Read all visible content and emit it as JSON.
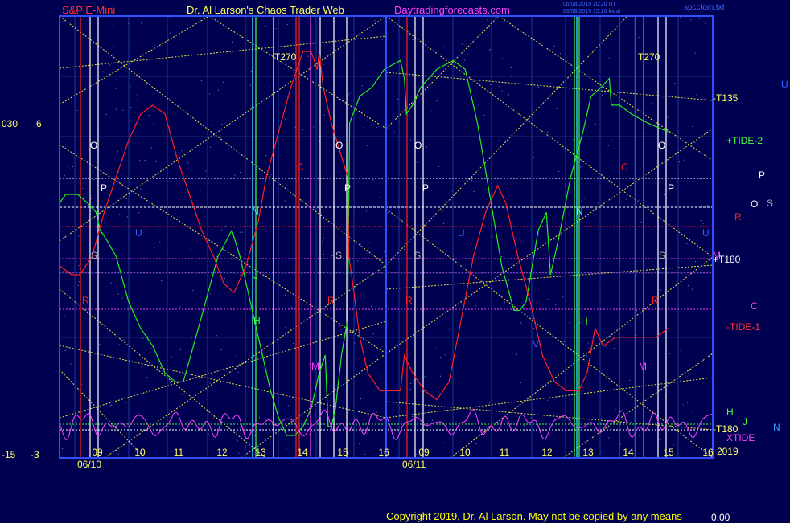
{
  "header": {
    "instrument": "S&P E-Mini",
    "site": "Dr. Al Larson's Chaos Trader Web",
    "url": "Daytradingforecasts.com",
    "stamp1": "06/08/2019 20:20 UT",
    "stamp2": "06/08/2019 15:20 local",
    "file": "spcctom.txt"
  },
  "left_scale": {
    "top_a": "030",
    "top_b": "6",
    "bot_a": "-15",
    "bot_b": "-3"
  },
  "footer": {
    "copyright": "Copyright 2019, Dr. Al Larson. May not be copied by any means",
    "value": "0.00"
  },
  "colors": {
    "background": "#000050",
    "frame": "#3050ff",
    "accent_red": "#ff2020",
    "accent_green": "#20ff20",
    "accent_magenta": "#ff40ff",
    "accent_yellow": "#ffff00"
  },
  "right_labels": [
    {
      "text": "-T135",
      "color": "#ffff66"
    },
    {
      "text": "+TIDE-2",
      "color": "#40ff40"
    },
    {
      "text": "P",
      "color": "#ffffff"
    },
    {
      "text": "O",
      "color": "#ffffff"
    },
    {
      "text": "S",
      "color": "#b0b0b0"
    },
    {
      "text": "R",
      "color": "#ff2020"
    },
    {
      "text": "U",
      "color": "#3060ff"
    },
    {
      "text": "M",
      "color": "#ff40ff"
    },
    {
      "text": "+T180",
      "color": "#ffffff"
    },
    {
      "text": "C",
      "color": "#ff40ff"
    },
    {
      "text": "-TIDE-1",
      "color": "#ff3030"
    },
    {
      "text": "H",
      "color": "#40ff40"
    },
    {
      "text": "J",
      "color": "#40ff40"
    },
    {
      "text": "-T180",
      "color": "#ffff66"
    },
    {
      "text": "XTIDE",
      "color": "#ff40ff"
    },
    {
      "text": "N",
      "color": "#40a0ff"
    },
    {
      "text": "2019",
      "color": "#ffff66"
    }
  ],
  "chart_data": {
    "type": "line",
    "title": "S&P E-Mini",
    "ylim": [
      -15,
      30
    ],
    "x_tick_labels": [
      "09",
      "10",
      "11",
      "12",
      "13",
      "14",
      "15",
      "16",
      "09",
      "10",
      "11",
      "12",
      "13",
      "14",
      "15",
      "16"
    ],
    "date_labels": [
      "06/10",
      "06/11"
    ],
    "series": [
      {
        "name": "+TIDE-2",
        "color": "#22ee22",
        "points": [
          [
            0,
            11
          ],
          [
            0.15,
            12
          ],
          [
            0.45,
            12
          ],
          [
            0.7,
            11
          ],
          [
            0.9,
            10
          ],
          [
            1.0,
            8
          ],
          [
            1.15,
            7
          ],
          [
            1.4,
            5
          ],
          [
            1.7,
            0
          ],
          [
            2.0,
            -3
          ],
          [
            2.3,
            -5
          ],
          [
            2.6,
            -8
          ],
          [
            2.85,
            -9
          ],
          [
            3.05,
            -9
          ],
          [
            3.3,
            -5
          ],
          [
            3.6,
            0
          ],
          [
            3.9,
            5
          ],
          [
            4.25,
            8
          ],
          [
            4.45,
            5
          ],
          [
            4.6,
            2
          ],
          [
            4.8,
            -2
          ],
          [
            5.0,
            -6
          ],
          [
            5.2,
            -10
          ],
          [
            5.4,
            -13
          ],
          [
            5.6,
            -15
          ],
          [
            5.8,
            -15
          ],
          [
            6.0,
            -14
          ],
          [
            6.2,
            -12
          ],
          [
            6.4,
            -8
          ],
          [
            6.55,
            -6
          ],
          [
            6.62,
            -14
          ],
          [
            6.7,
            -14
          ],
          [
            6.8,
            -12
          ],
          [
            6.95,
            -6
          ],
          [
            7.1,
            -2
          ],
          [
            7.15,
            20
          ],
          [
            7.4,
            23
          ],
          [
            7.7,
            24
          ],
          [
            8.0,
            26
          ],
          [
            8.4,
            27
          ],
          [
            8.5,
            25
          ],
          [
            8.55,
            21
          ],
          [
            8.7,
            22
          ],
          [
            8.9,
            24
          ],
          [
            9.3,
            26
          ],
          [
            9.7,
            27
          ],
          [
            10.0,
            26
          ],
          [
            10.3,
            20
          ],
          [
            10.6,
            12
          ],
          [
            10.9,
            4
          ],
          [
            11.2,
            -1
          ],
          [
            11.35,
            -1
          ],
          [
            11.5,
            0
          ],
          [
            11.8,
            8
          ],
          [
            12.0,
            10
          ],
          [
            12.1,
            3
          ],
          [
            12.3,
            7
          ],
          [
            12.6,
            14
          ],
          [
            12.9,
            19
          ],
          [
            13.1,
            23
          ],
          [
            13.35,
            24
          ],
          [
            13.55,
            25
          ],
          [
            13.6,
            22
          ],
          [
            13.8,
            22
          ],
          [
            14.1,
            21
          ],
          [
            14.5,
            20
          ],
          [
            15.0,
            19
          ]
        ]
      },
      {
        "name": "-TIDE-1",
        "color": "#ff2020",
        "points": [
          [
            0,
            4
          ],
          [
            0.3,
            3
          ],
          [
            0.5,
            3
          ],
          [
            0.8,
            5
          ],
          [
            1.1,
            10
          ],
          [
            1.4,
            14
          ],
          [
            1.7,
            18
          ],
          [
            2.0,
            21
          ],
          [
            2.3,
            22
          ],
          [
            2.6,
            21
          ],
          [
            2.9,
            16
          ],
          [
            3.2,
            12
          ],
          [
            3.5,
            8
          ],
          [
            3.8,
            5
          ],
          [
            4.05,
            2
          ],
          [
            4.3,
            1
          ],
          [
            4.6,
            4
          ],
          [
            4.9,
            9
          ],
          [
            5.1,
            14
          ],
          [
            5.4,
            19
          ],
          [
            5.7,
            24
          ],
          [
            6.0,
            28
          ],
          [
            6.2,
            28
          ],
          [
            6.35,
            26
          ],
          [
            6.4,
            28
          ],
          [
            6.5,
            24
          ],
          [
            6.7,
            20
          ],
          [
            6.9,
            17
          ],
          [
            7.1,
            14
          ],
          [
            7.13,
            5
          ],
          [
            7.2,
            3
          ],
          [
            7.4,
            -4
          ],
          [
            7.6,
            -8
          ],
          [
            7.9,
            -10
          ],
          [
            8.4,
            -10
          ],
          [
            8.5,
            -6
          ],
          [
            8.7,
            -8
          ],
          [
            9.0,
            -10
          ],
          [
            9.3,
            -11
          ],
          [
            9.6,
            -9
          ],
          [
            9.9,
            -2
          ],
          [
            10.2,
            5
          ],
          [
            10.5,
            10
          ],
          [
            10.8,
            13
          ],
          [
            11.0,
            11
          ],
          [
            11.3,
            5
          ],
          [
            11.6,
            0
          ],
          [
            11.9,
            -6
          ],
          [
            12.2,
            -9
          ],
          [
            12.5,
            -10
          ],
          [
            12.8,
            -10
          ],
          [
            13.0,
            -8
          ],
          [
            13.2,
            -3
          ],
          [
            13.4,
            -5
          ],
          [
            13.7,
            -4
          ],
          [
            14.2,
            -4
          ],
          [
            14.7,
            -4
          ],
          [
            15.0,
            -3
          ]
        ]
      }
    ]
  }
}
